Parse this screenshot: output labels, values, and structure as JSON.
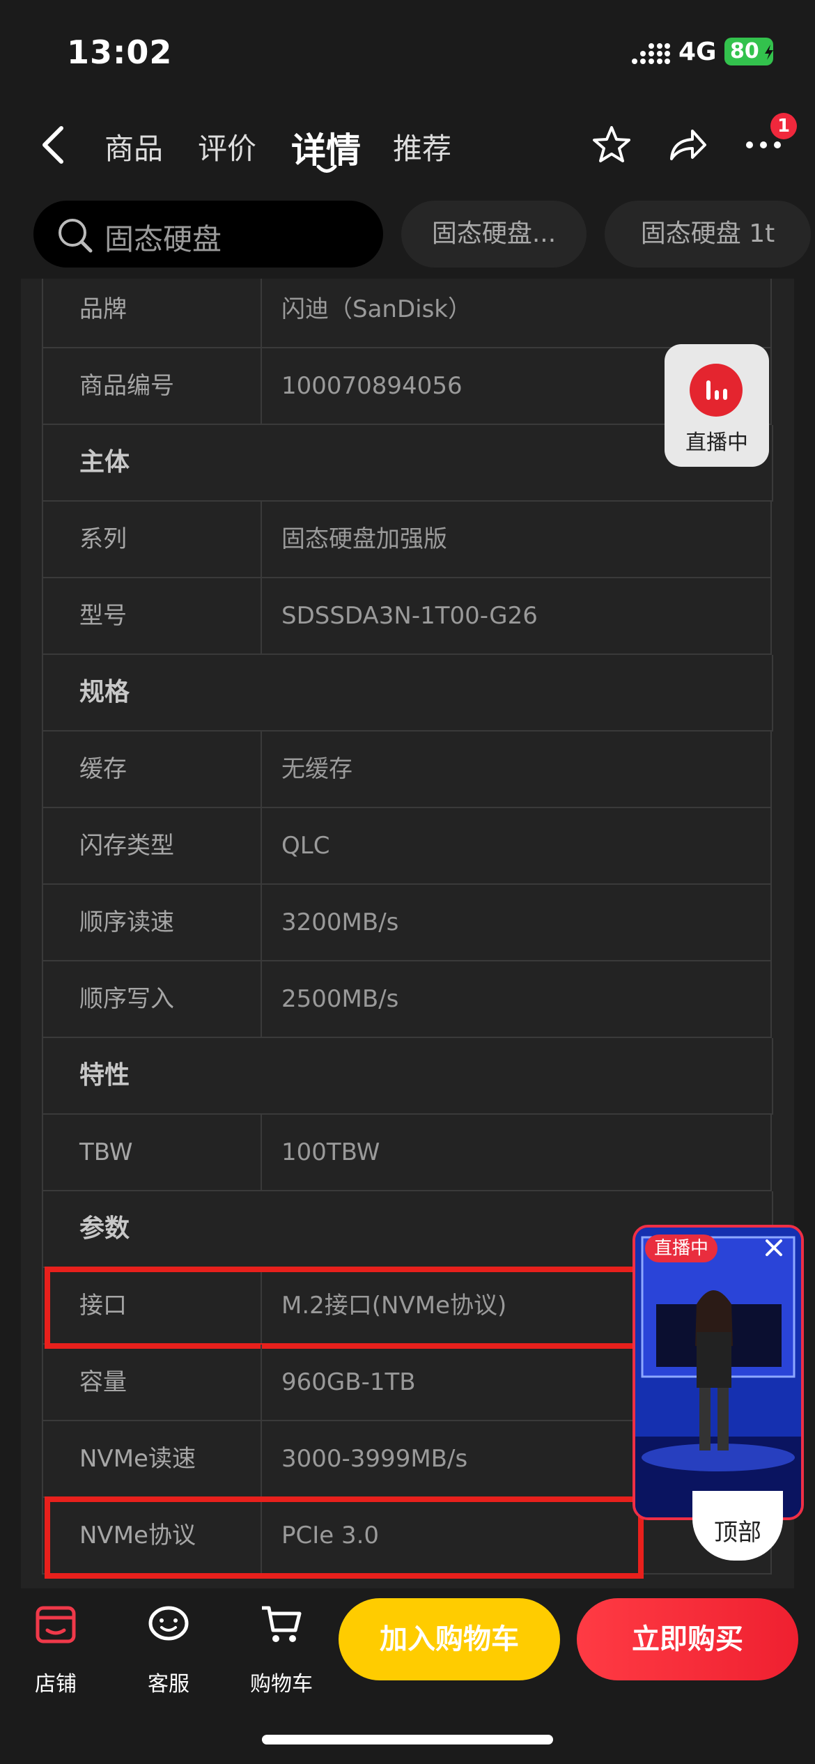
{
  "status": {
    "time": "13:02",
    "network": "4G",
    "battery": "80"
  },
  "nav": {
    "tabs": [
      "商品",
      "评价",
      "详情",
      "推荐"
    ],
    "active_tab": "详情",
    "badge": "1"
  },
  "search": {
    "query": "固态硬盘",
    "chips": [
      "固态硬盘...",
      "固态硬盘 1t"
    ]
  },
  "specs": [
    {
      "type": "row",
      "key": "品牌",
      "value": "闪迪（SanDisk）"
    },
    {
      "type": "row",
      "key": "商品编号",
      "value": "100070894056"
    },
    {
      "type": "section",
      "title": "主体"
    },
    {
      "type": "row",
      "key": "系列",
      "value": "固态硬盘加强版"
    },
    {
      "type": "row",
      "key": "型号",
      "value": "SDSSDA3N-1T00-G26"
    },
    {
      "type": "section",
      "title": "规格"
    },
    {
      "type": "row",
      "key": "缓存",
      "value": "无缓存"
    },
    {
      "type": "row",
      "key": "闪存类型",
      "value": "QLC"
    },
    {
      "type": "row",
      "key": "顺序读速",
      "value": "3200MB/s"
    },
    {
      "type": "row",
      "key": "顺序写入",
      "value": "2500MB/s"
    },
    {
      "type": "section",
      "title": "特性"
    },
    {
      "type": "row",
      "key": "TBW",
      "value": "100TBW"
    },
    {
      "type": "section",
      "title": "参数"
    },
    {
      "type": "row",
      "key": "接口",
      "value": "M.2接口(NVMe协议)",
      "highlight": true
    },
    {
      "type": "row",
      "key": "容量",
      "value": "960GB-1TB"
    },
    {
      "type": "row",
      "key": "NVMe读速",
      "value": "3000-3999MB/s"
    },
    {
      "type": "row",
      "key": "NVMe协议",
      "value": "PCIe 3.0",
      "highlight": true
    }
  ],
  "live": {
    "button_label": "直播中",
    "tag": "直播中",
    "top_label": "顶部"
  },
  "bottom": {
    "store": "店铺",
    "service": "客服",
    "cart": "购物车",
    "add_to_cart": "加入购物车",
    "buy_now": "立即购买"
  },
  "colors": {
    "highlight": "#e8201c",
    "cart_btn": "#ffcc00",
    "buy_btn": "#ef2030",
    "accent": "#e4252f"
  }
}
